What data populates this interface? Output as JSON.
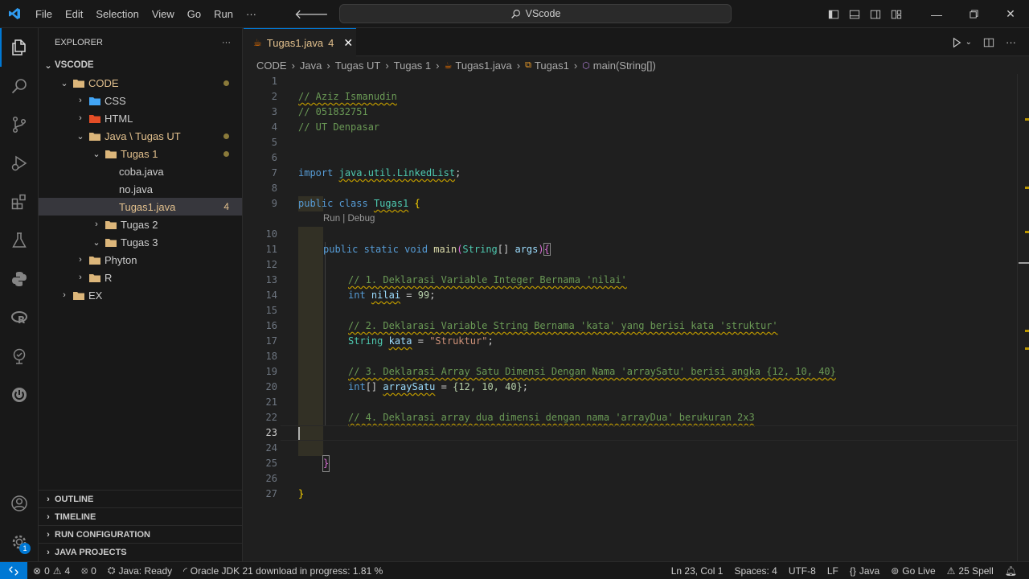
{
  "titlebar": {
    "menu": [
      "File",
      "Edit",
      "Selection",
      "View",
      "Go",
      "Run",
      "···"
    ],
    "search": "VScode",
    "icons": [
      "back-arrow-icon",
      "forward-arrow-icon",
      "search-icon",
      "toggle-sidebar-icon",
      "toggle-panel-icon",
      "toggle-secondary-sidebar-icon",
      "customize-layout-icon",
      "minimize-icon",
      "restore-icon",
      "close-icon"
    ]
  },
  "explorer": {
    "title": "EXPLORER",
    "more": "···",
    "root": "VSCODE",
    "tree": [
      {
        "label": "CODE",
        "depth": 1,
        "expanded": true,
        "modified": true
      },
      {
        "label": "CSS",
        "depth": 2,
        "expanded": false
      },
      {
        "label": "HTML",
        "depth": 2,
        "expanded": false
      },
      {
        "label": "Java \\ Tugas UT",
        "depth": 2,
        "expanded": true,
        "modified": true
      },
      {
        "label": "Tugas 1",
        "depth": 3,
        "expanded": true,
        "modified": true
      },
      {
        "label": "coba.java",
        "depth": 4
      },
      {
        "label": "no.java",
        "depth": 4
      },
      {
        "label": "Tugas1.java",
        "depth": 4,
        "selected": true,
        "count": "4"
      },
      {
        "label": "Tugas 2",
        "depth": 3,
        "expanded": false
      },
      {
        "label": "Tugas 3",
        "depth": 3,
        "expanded": true
      },
      {
        "label": "Phyton",
        "depth": 2,
        "expanded": false
      },
      {
        "label": "R",
        "depth": 2,
        "expanded": false
      },
      {
        "label": "EX",
        "depth": 1,
        "expanded": false
      }
    ],
    "sections": [
      "OUTLINE",
      "TIMELINE",
      "RUN CONFIGURATION",
      "JAVA PROJECTS"
    ]
  },
  "editor": {
    "tab": {
      "label": "Tugas1.java",
      "problems": "4",
      "close": "✕"
    },
    "breadcrumb": [
      "CODE",
      "Java",
      "Tugas UT",
      "Tugas 1",
      "Tugas1.java",
      "Tugas1",
      "main(String[])"
    ],
    "codelens": "Run | Debug",
    "line_numbers": [
      "1",
      "2",
      "3",
      "4",
      "5",
      "6",
      "7",
      "8",
      "9",
      "10",
      "11",
      "12",
      "13",
      "14",
      "15",
      "16",
      "17",
      "18",
      "19",
      "20",
      "21",
      "22",
      "23",
      "24",
      "25",
      "26",
      "27"
    ],
    "current_line": "23",
    "lines": {
      "l1": "// Aziz Ismanudin",
      "l2": "// 051832751",
      "l3": "// UT Denpasar",
      "l6_kw": "import",
      "l6_pkg": "java.util.LinkedList",
      "l6_end": ";",
      "l8_kw": "public class",
      "l8_name": "Tugas1",
      "l8_br": "{",
      "l10_kw": "public static void",
      "l10_fn": "main",
      "l10_type": "String",
      "l10_arr": "[]",
      "l10_arg": "args",
      "l12": "// 1. Deklarasi Variable Integer Bernama 'nilai'",
      "l13_kw": "int",
      "l13_var": "nilai",
      "l13_eq": " = ",
      "l13_num": "99",
      "l15": "// 2. Deklarasi Variable String Bernama 'kata' yang berisi kata 'struktur'",
      "l16_type": "String",
      "l16_var": "kata",
      "l16_str": "\"Struktur\"",
      "l18": "// 3. Deklarasi Array Satu Dimensi Dengan Nama 'arraySatu' berisi angka {12, 10, 40}",
      "l19_kw": "int",
      "l19_var": "arraySatu",
      "l19_vals": "{12, 10, 40}",
      "l21": "// 4. Deklarasi array dua dimensi dengan nama 'arrayDua' berukuran 2x3",
      "l24": "}",
      "l26": "}"
    }
  },
  "statusbar": {
    "errors": "0",
    "warnings": "4",
    "ports": "0",
    "java": "Java: Ready",
    "jdk": "Oracle JDK 21 download in progress: 1.81 %",
    "position": "Ln 23, Col 1",
    "spaces": "Spaces: 4",
    "encoding": "UTF-8",
    "eol": "LF",
    "language": "Java",
    "golive": "Go Live",
    "spell": "25 Spell"
  },
  "activity": {
    "icons": [
      "explorer-icon",
      "search-icon",
      "source-control-icon",
      "run-debug-icon",
      "extensions-icon",
      "testing-icon",
      "python-icon",
      "r-icon",
      "remote-explorer-icon",
      "spring-boot-icon",
      "account-icon",
      "manage-gear-icon"
    ],
    "manage_badge": "1"
  },
  "colors": {
    "accent": "#0078d4",
    "modified": "#e2c08d",
    "comment": "#6a9955",
    "keyword": "#569cd6"
  }
}
